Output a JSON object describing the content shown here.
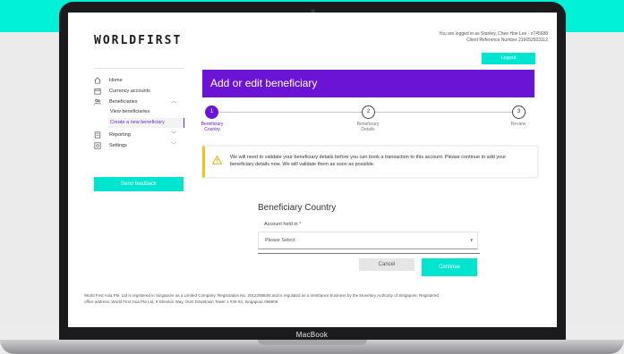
{
  "device": {
    "label": "MacBook"
  },
  "header": {
    "logo": "WORLDFIRST",
    "login_line1": "You are logged in as Stanley, Chee Hoe Lee - s745688",
    "login_line2": "Client Reference Number 216052503112",
    "logout_label": "Logout"
  },
  "sidebar": {
    "items": [
      {
        "label": "Home",
        "icon": "home-icon"
      },
      {
        "label": "Currency accounts",
        "icon": "currency-accounts-icon"
      },
      {
        "label": "Beneficiaries",
        "icon": "beneficiaries-icon"
      },
      {
        "label": "Reporting",
        "icon": "reporting-icon"
      },
      {
        "label": "Settings",
        "icon": "settings-icon"
      }
    ],
    "sub_items": [
      {
        "label": "View beneficiaries"
      },
      {
        "label": "Create a new beneficiary"
      }
    ],
    "feedback_label": "Send feedback"
  },
  "main": {
    "banner_title": "Add or edit beneficiary",
    "steps": [
      {
        "number": "1",
        "label_line1": "Beneficiary",
        "label_line2": "Country"
      },
      {
        "number": "2",
        "label_line1": "Beneficiary",
        "label_line2": "Details"
      },
      {
        "number": "3",
        "label_line1": "Review",
        "label_line2": ""
      }
    ],
    "notice_text": "We will need to validate your beneficiary details before you can book a transaction to this account. Please continue to add your beneficiary details now. We will validate them as soon as possible.",
    "form_title": "Beneficiary Country",
    "field_label": "Account held in",
    "required_mark": "*",
    "select_placeholder": "Please Select",
    "cancel_label": "Cancel",
    "continue_label": "Continue"
  },
  "footer": {
    "line1": "World First Asia Pte. Ltd is registered in Singapore as a Limited Company: Registration No. 201229884N and is regulated as a remittance business by the Monetary Authority of Singapore. Registered",
    "line2": "office address: World First Asia Pte Ltd, 6 Shenton Way, OUE Downtown Tower 1 #36-03, Singapore 068809."
  },
  "colors": {
    "accent": "#00e5cf",
    "brand": "#6b14d6",
    "warning": "#f0c419",
    "backdrop": "#00f0d8"
  }
}
